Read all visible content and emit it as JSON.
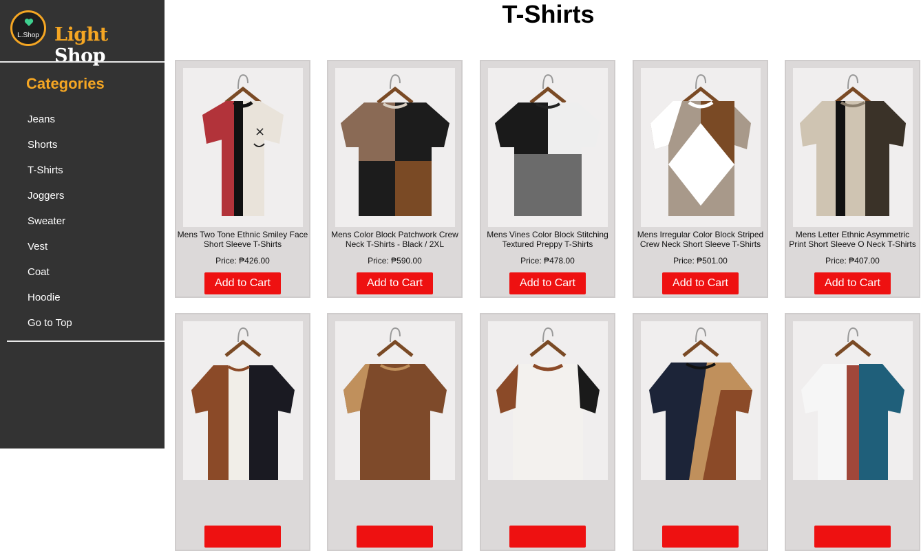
{
  "brand": {
    "logo_text": "L.Shop",
    "name_light": "Light",
    "name_shop": "Shop"
  },
  "sidebar": {
    "title": "Categories",
    "items": [
      "Jeans",
      "Shorts",
      "T-Shirts",
      "Joggers",
      "Sweater",
      "Vest",
      "Coat",
      "Hoodie",
      "Go to Top"
    ]
  },
  "page": {
    "title": "T-Shirts"
  },
  "products": [
    {
      "name": "Mens Two Tone Ethnic Smiley Face Short Sleeve T-Shirts",
      "price": "Price: ₱426.00",
      "button": "Add to Cart"
    },
    {
      "name": "Mens Color Block Patchwork Crew Neck T-Shirts - Black / 2XL",
      "price": "Price: ₱590.00",
      "button": "Add to Cart"
    },
    {
      "name": "Mens Vines Color Block Stitching Textured Preppy T-Shirts",
      "price": "Price: ₱478.00",
      "button": "Add to Cart"
    },
    {
      "name": "Mens Irregular Color Block Striped Crew Neck Short Sleeve T-Shirts",
      "price": "Price: ₱501.00",
      "button": "Add to Cart"
    },
    {
      "name": "Mens Letter Ethnic Asymmetric Print Short Sleeve O Neck T-Shirts",
      "price": "Price: ₱407.00",
      "button": "Add to Cart"
    },
    {
      "name": "",
      "price": "",
      "button": ""
    },
    {
      "name": "",
      "price": "",
      "button": ""
    },
    {
      "name": "",
      "price": "",
      "button": ""
    },
    {
      "name": "",
      "price": "",
      "button": ""
    },
    {
      "name": "",
      "price": "",
      "button": ""
    }
  ],
  "colors": {
    "accent": "#f5a623",
    "sidebar_bg": "#333333",
    "button_bg": "#ee1111",
    "card_bg": "#dcd9d9"
  }
}
